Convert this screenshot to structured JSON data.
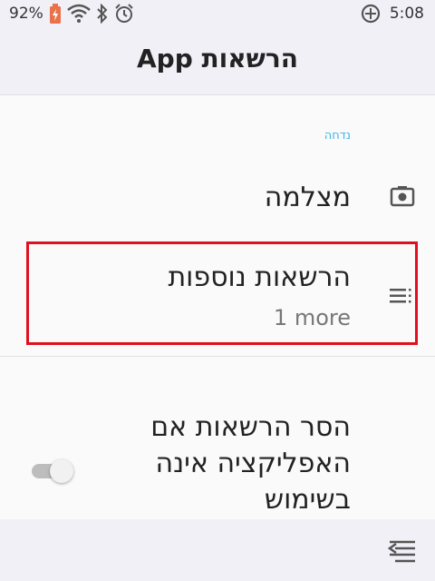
{
  "status_bar": {
    "battery_percent": "92%",
    "time": "5:08",
    "icons": [
      "battery-charging-icon",
      "wifi-icon",
      "bluetooth-icon",
      "alarm-icon",
      "data-saver-icon"
    ]
  },
  "app_bar": {
    "title": "הרשאות App"
  },
  "content": {
    "section_header": "נדחה",
    "items": [
      {
        "title": "מצלמה",
        "icon": "camera-icon"
      },
      {
        "title": "הרשאות נוספות",
        "summary": "1 more",
        "icon": "list-icon",
        "highlighted": true
      },
      {
        "title": "הסר הרשאות אם האפליקציה אינה בשימוש",
        "toggle_on": false
      }
    ]
  },
  "bottom_bar": {
    "icon": "nav-menu-icon"
  },
  "colors": {
    "accent": "#3fb7e6",
    "highlight": "#e11020",
    "bar_background": "#f1f0f7"
  }
}
